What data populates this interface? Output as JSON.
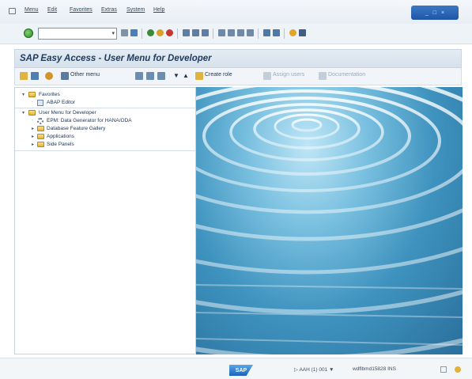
{
  "menubar": {
    "items": [
      "Menu",
      "Edit",
      "Favorites",
      "Extras",
      "System",
      "Help"
    ]
  },
  "window_controls": {
    "minimize": "_",
    "restore": "□",
    "close": "×"
  },
  "command_field": {
    "value": "",
    "placeholder": ""
  },
  "page": {
    "title": "SAP Easy Access  -  User Menu for Developer"
  },
  "app_toolbar": {
    "other_menu": "Other menu",
    "create_role": "Create role",
    "assign_users": "Assign users",
    "documentation": "Documentation"
  },
  "tree": {
    "favorites": "Favorites",
    "abap_editor": "ABAP Editor",
    "user_menu": "User Menu for Developer",
    "epm_generator": "EPM: Data Generator for HANA/ODA",
    "db_feature_gallery": "Database Feature Gallery",
    "applications": "Applications",
    "side_panels": "Side Panels"
  },
  "status": {
    "sap_logo": "SAP",
    "system_info": "▷  AAH (1) 001 ▼",
    "user_host": "wdflbmd15828   INS"
  },
  "colors": {
    "menubar_bg": "#e8eef5",
    "title_text": "#1e3a5c",
    "accent_blue": "#1f56a6",
    "water": "#3f93bf"
  }
}
